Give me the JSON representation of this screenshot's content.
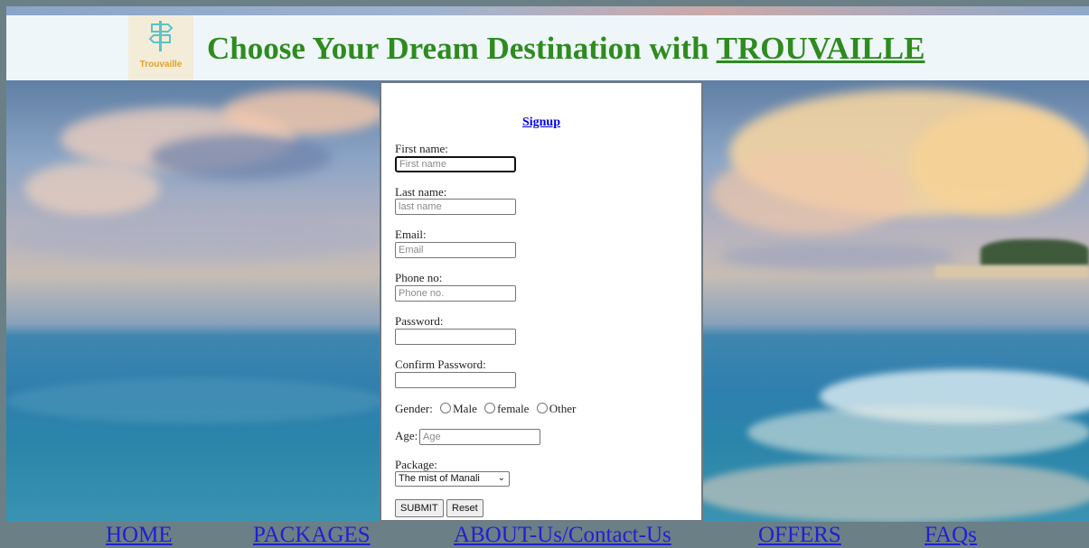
{
  "header": {
    "logo_text": "Trouvaille",
    "title_prefix": "Choose Your Dream Destination with ",
    "title_brand": "TROUVAILLE"
  },
  "form": {
    "signup_link": "Signup",
    "first_name": {
      "label": "First name:",
      "placeholder": "First name"
    },
    "last_name": {
      "label": "Last name:",
      "placeholder": "last name"
    },
    "email": {
      "label": "Email:",
      "placeholder": "Email"
    },
    "phone": {
      "label": "Phone no:",
      "placeholder": "Phone no."
    },
    "password": {
      "label": "Password:"
    },
    "confirm_password": {
      "label": "Confirm Password:"
    },
    "gender": {
      "label": "Gender:",
      "options": [
        "Male",
        "female",
        "Other"
      ]
    },
    "age": {
      "label": "Age:",
      "placeholder": "Age"
    },
    "package": {
      "label": "Package:",
      "selected": "The mist of Manali"
    },
    "submit_label": "SUBMIT",
    "reset_label": "Reset"
  },
  "nav": {
    "items": [
      "HOME",
      "PACKAGES",
      "ABOUT-Us/Contact-Us",
      "OFFERS",
      "FAQs"
    ]
  },
  "colors": {
    "title": "#2e8b1e",
    "link": "#0000ee",
    "nav_link": "#1f1fd6",
    "nav_bg": "#6b7f86",
    "header_bg": "#eef6fa"
  }
}
